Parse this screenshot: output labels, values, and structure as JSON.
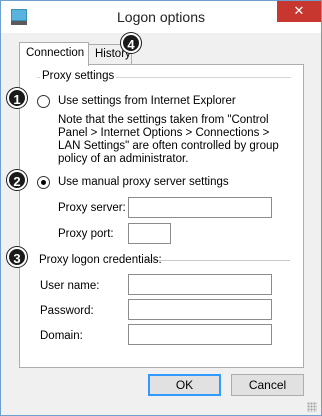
{
  "window": {
    "title": "Logon options",
    "close_glyph": "✕"
  },
  "tabs": [
    {
      "label": "Connection"
    },
    {
      "label": "History"
    }
  ],
  "proxy_settings": {
    "group_title": "Proxy settings",
    "option_ie": "Use settings from Internet Explorer",
    "note": "Note that the settings taken from \"Control Panel > Internet Options > Connections > LAN Settings\" are often controlled by group policy of an administrator.",
    "option_manual": "Use manual proxy server settings",
    "selected": "manual",
    "server_label": "Proxy server:",
    "server_value": "",
    "port_label": "Proxy port:",
    "port_value": ""
  },
  "credentials": {
    "group_title": "Proxy logon credentials:",
    "username_label": "User name:",
    "username_value": "",
    "password_label": "Password:",
    "password_value": "",
    "domain_label": "Domain:",
    "domain_value": ""
  },
  "buttons": {
    "ok": "OK",
    "cancel": "Cancel"
  },
  "badges": [
    "1",
    "2",
    "3",
    "4"
  ],
  "colors": {
    "close_red": "#c7372f",
    "window_border": "#6f9fcf",
    "default_button_border": "#3399ff"
  }
}
